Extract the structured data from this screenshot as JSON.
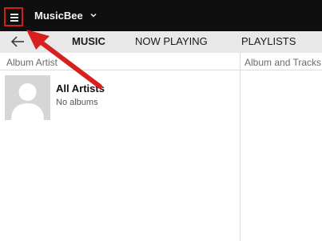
{
  "app": {
    "title": "MusicBee",
    "menu_icon": "hamburger-menu-icon"
  },
  "nav": {
    "back_icon": "back-arrow-icon",
    "tabs": [
      {
        "label": "MUSIC",
        "active": true
      },
      {
        "label": "NOW PLAYING",
        "active": false
      },
      {
        "label": "PLAYLISTS",
        "active": false
      }
    ]
  },
  "columns": {
    "left_header": "Album Artist",
    "right_header": "Album and Tracks"
  },
  "artists": [
    {
      "name": "All Artists",
      "subtitle": "No albums"
    }
  ],
  "colors": {
    "titlebar": "#0f0f0f",
    "navbar": "#e8e8e8",
    "highlight_box": "#d41c1c",
    "annotation_arrow": "#d71f1f"
  }
}
